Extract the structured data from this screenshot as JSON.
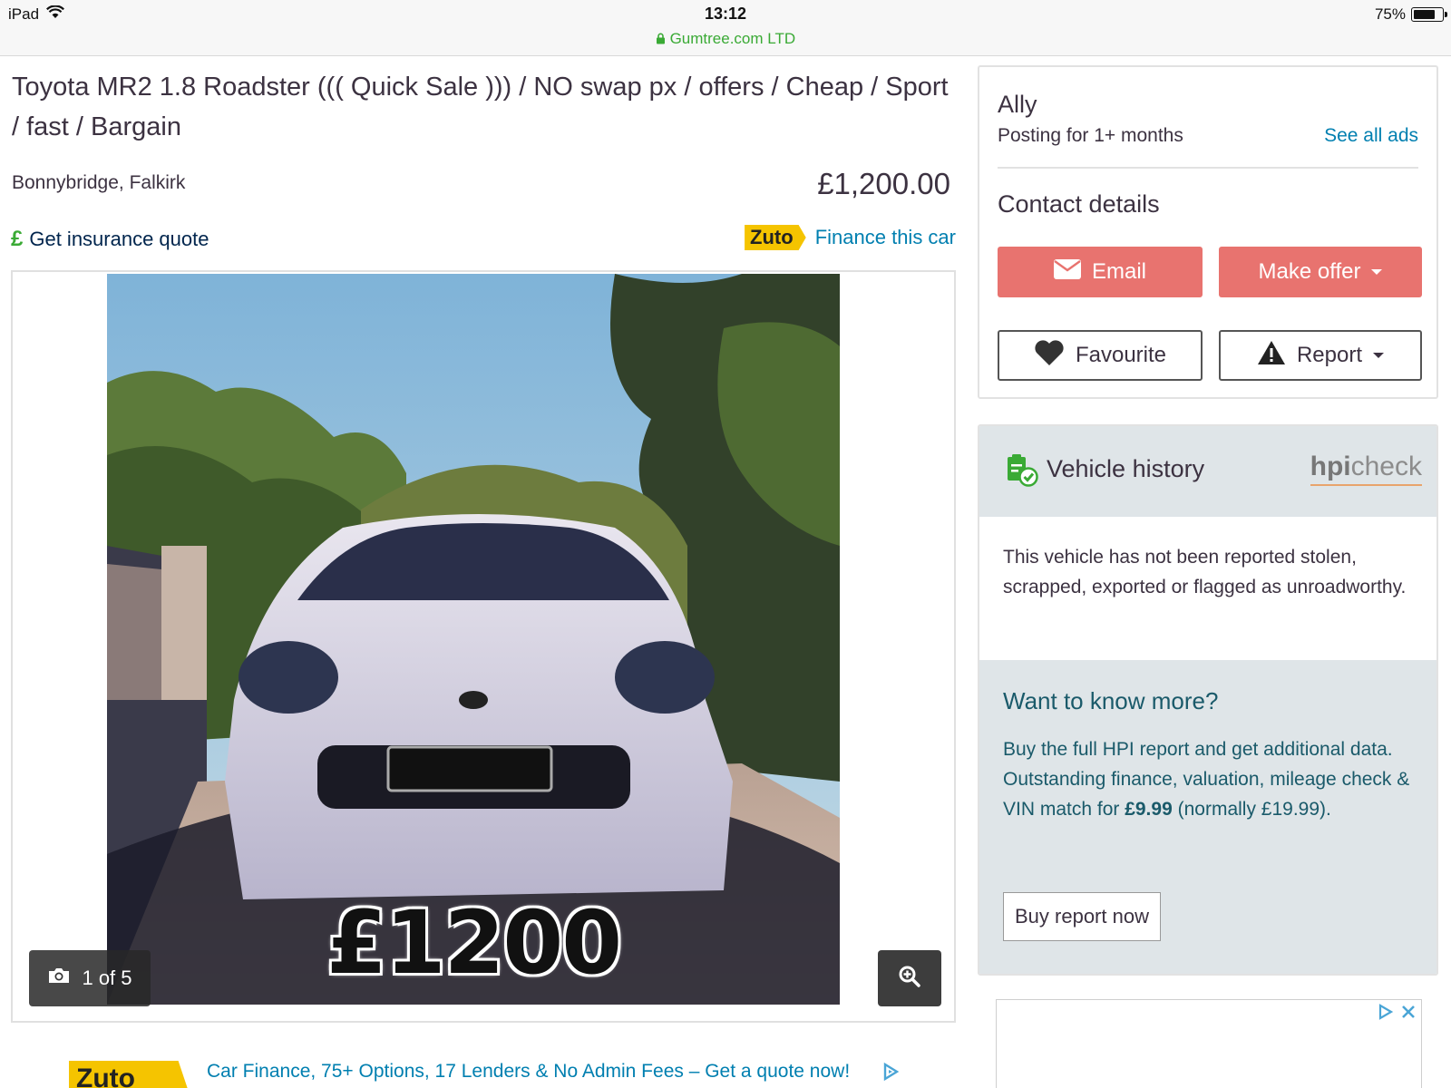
{
  "status_bar": {
    "device": "iPad",
    "time": "13:12",
    "url": "Gumtree.com LTD",
    "battery": "75%",
    "battery_level": 0.75
  },
  "listing": {
    "title": "Toyota MR2 1.8 Roadster ((( Quick Sale ))) / NO swap px / offers / Cheap / Sport / fast / Bargain",
    "location": "Bonnybridge, Falkirk",
    "price": "£1,200.00",
    "insurance_link": "Get insurance quote",
    "insurance_icon": "£",
    "finance_brand": "Zuto",
    "finance_link": "Finance this car"
  },
  "gallery": {
    "photo_price_text": "£1200",
    "counter": "1 of 5",
    "camera_icon": "camera-icon",
    "zoom_icon": "zoom-in-icon"
  },
  "banner": {
    "brand": "Zuto",
    "text": "Car Finance, 75+ Options, 17 Lenders & No Admin Fees – Get a quote now!"
  },
  "seller": {
    "name": "Ally",
    "since": "Posting for 1+ months",
    "see_all": "See all ads",
    "contact_title": "Contact details",
    "email_label": "Email",
    "offer_label": "Make offer",
    "favourite_label": "Favourite",
    "report_label": "Report"
  },
  "vehicle_history": {
    "title": "Vehicle history",
    "logo_bold": "hpi",
    "logo_light": "check",
    "description": "This vehicle has not been reported stolen, scrapped, exported or flagged as unroadworthy.",
    "more_title": "Want to know more?",
    "more_line1": "Buy the full HPI report and get additional data.",
    "more_line2_a": "Outstanding finance, valuation, mileage check & VIN match for ",
    "more_price": "£9.99",
    "more_line2_b": " (normally £19.99).",
    "buy_button": "Buy report now"
  },
  "colors": {
    "brand_green": "#3aaa35",
    "link_blue": "#007fb0",
    "action_red": "#e8736f",
    "panel_grey": "#dfe5e8",
    "zuto_yellow": "#f5c400"
  }
}
